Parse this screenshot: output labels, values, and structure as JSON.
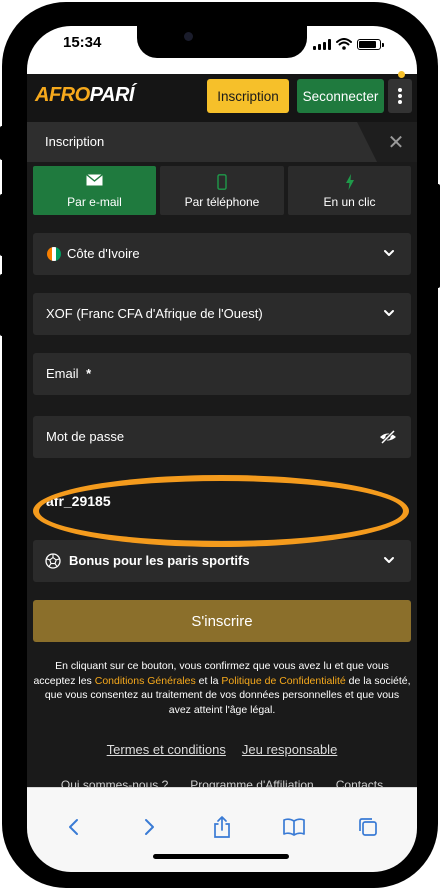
{
  "status_bar": {
    "time": "15:34"
  },
  "header": {
    "logo_part1": "AFRO",
    "logo_part2": "PARÍ",
    "inscription_label": "Inscription",
    "connect_label": "Seconnecter"
  },
  "modal": {
    "title": "Inscription"
  },
  "methods": [
    {
      "label": "Par e-mail",
      "icon": "envelope-icon",
      "active": true
    },
    {
      "label": "Par téléphone",
      "icon": "phone-icon",
      "active": false
    },
    {
      "label": "En un clic",
      "icon": "lightning-icon",
      "active": false
    }
  ],
  "form": {
    "country": "Côte d'Ivoire",
    "currency": "XOF (Franc CFA d'Afrique de l'Ouest)",
    "email_label": "Email",
    "required_mark": "*",
    "password_label": "Mot de passe",
    "promo_value": "afr_29185",
    "bonus_label": "Bonus pour les paris sportifs",
    "submit_label": "S'inscrire"
  },
  "legal": {
    "part1": "En cliquant sur ce bouton, vous confirmez que vous avez lu et que vous acceptez les ",
    "link1": "Conditions Générales",
    "part2": " et la ",
    "link2": "Politique de Confidentialité",
    "part3": " de la société, que vous consentez au traitement de vos données personnelles et que vous avez atteint l'âge légal."
  },
  "footer": {
    "terms": "Termes et conditions",
    "responsible": "Jeu responsable",
    "about": "Qui sommes-nous ?",
    "affiliate": "Programme d'Affiliation",
    "contacts": "Contacts"
  },
  "colors": {
    "brand_orange": "#f6a91c",
    "inscription_yellow": "#f6c02a",
    "connect_green": "#1f7a3e",
    "highlight_orange": "#f49b1d",
    "submit_gold": "#8b6f2b",
    "flag": [
      "#f77f00",
      "#ffffff",
      "#009e60"
    ]
  }
}
